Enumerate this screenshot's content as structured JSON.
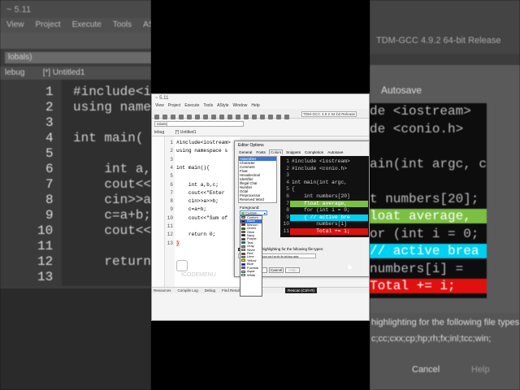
{
  "background_left": {
    "title": "~ 5.11",
    "menu": [
      "View",
      "Project",
      "Execute",
      "Tools",
      "AStyle"
    ],
    "combo": "lobals)",
    "tab": "[*] Untitled1",
    "tab_left": "lebug",
    "line_numbers": [
      "1",
      "2",
      "3",
      "4",
      "5",
      "6",
      "7",
      "8",
      "9",
      "10",
      "11",
      "12",
      "13"
    ],
    "code": [
      "#include<i",
      "using name",
      "",
      "int main(",
      "",
      "    int a,",
      "    cout<<",
      "    cin>>a",
      "    c=a+b;",
      "    cout<<",
      "",
      "    return",
      ""
    ]
  },
  "background_right": {
    "compiler": "TDM-GCC 4.9.2 64-bit Release",
    "tab": "Autosave",
    "code": [
      "de <iostream>",
      "de <conio.h>",
      "",
      "ain(int argc, c",
      "",
      "t numbers[20];",
      "loat average,",
      "or (int i = 0;",
      "// active brea",
      "numbers[i] =",
      "Total += i;"
    ],
    "bottom_text": "highlighting for the following file types:",
    "extensions": "c;cc;cxx;cp;hp;rh;fx;inl;tcc;win;",
    "cancel": "Cancel",
    "help": "Help"
  },
  "screenshot": {
    "title": "~ 5.11",
    "menu": [
      "View",
      "Project",
      "Execute",
      "Tools",
      "AStyle",
      "Window",
      "Help"
    ],
    "compiler": "TDM-GCC 4.9.2 64-bit Release",
    "combo": "lobals)",
    "side_tab": "lebug",
    "tab": "[*] Untitled1",
    "line_numbers": [
      "1",
      "2",
      "3",
      "4",
      "5",
      "6",
      "7",
      "8",
      "9",
      "10",
      "11",
      "12",
      "13"
    ],
    "code": [
      "#include<iostream>",
      "using namespace s",
      "",
      "int main(){",
      "",
      "    int a,b,c;",
      "    cout<<\"Enter",
      "    cin>>a>>b;",
      "    c=a+b;",
      "    cout<<\"Sum of",
      "",
      "    return 0;",
      "}"
    ],
    "bottom_tabs": [
      "Resources",
      "Compile Log",
      "Debug",
      "Find Results"
    ],
    "watermark": "ICODEMENU",
    "tooltip": "Rescan (Ctrl+R)"
  },
  "dialog": {
    "title": "Editor Options",
    "tabs": [
      "General",
      "Fonts",
      "Colors",
      "Snippets",
      "Completion",
      "Autosave"
    ],
    "active_tab": "Colors",
    "elements": [
      "Assembler",
      "Character",
      "Comment",
      "Float",
      "Hexadecimal",
      "Identifier",
      "Illegal Char",
      "Number",
      "Octal",
      "Preprocessor",
      "Reserved Word"
    ],
    "selected_element": "Assembler",
    "foreground_label": "Foreground:",
    "foreground_value": "Custom...",
    "color_options": [
      {
        "name": "Custom...",
        "hex": "#7bc043"
      },
      {
        "name": "Black",
        "hex": "#000000"
      },
      {
        "name": "Maroon",
        "hex": "#800000"
      },
      {
        "name": "Green",
        "hex": "#008000"
      },
      {
        "name": "Olive",
        "hex": "#808000"
      },
      {
        "name": "Navy",
        "hex": "#000080"
      },
      {
        "name": "Purple",
        "hex": "#800080"
      },
      {
        "name": "Teal",
        "hex": "#008080"
      },
      {
        "name": "Gray",
        "hex": "#808080"
      },
      {
        "name": "Silver",
        "hex": "#c0c0c0"
      },
      {
        "name": "Red",
        "hex": "#ff0000"
      },
      {
        "name": "Lime",
        "hex": "#00ff00"
      },
      {
        "name": "Yellow",
        "hex": "#ffff00"
      },
      {
        "name": "Blue",
        "hex": "#0000ff"
      },
      {
        "name": "Fuchsia",
        "hex": "#ff00ff"
      },
      {
        "name": "Aqua",
        "hex": "#00ffff"
      },
      {
        "name": "White",
        "hex": "#ffffff"
      }
    ],
    "highlighted_color": "Black",
    "preview_line_numbers": [
      "1",
      "2",
      "3",
      "4",
      "5",
      "6",
      "7",
      "8",
      "9",
      "10",
      "11"
    ],
    "preview_code": [
      "#include <iostream>",
      "#include <conio.h>",
      "",
      "int main(int argc,",
      "{",
      "    int numbers[20]",
      "    float average,",
      "    for (int i = 0;",
      "    { // active bre",
      "        numbers[i] ",
      "        Total += i;"
    ],
    "highlight_colors": {
      "float": "#7bc043",
      "active": "#00d0f0",
      "total": "#e01010"
    },
    "checkbox_label": "Use syntax highlighting for the following file types:",
    "extensions": "c;cpp;h;hpp;cc;cxx;cp;hp;rh;fx;inl;tcc;win;",
    "buttons": {
      "ok": "OK",
      "cancel": "Cancel",
      "help": "Help"
    }
  }
}
